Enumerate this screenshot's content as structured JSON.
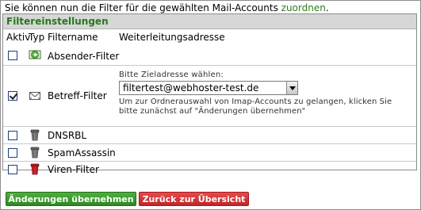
{
  "intro": {
    "text": "Sie können nun die Filter für die gewählten Mail-Accounts ",
    "link": "zuordnen",
    "suffix": "."
  },
  "box": {
    "title": "Filtereinstellungen"
  },
  "columns": {
    "active": "Aktiv",
    "type": "Typ",
    "name": "Filtername",
    "forward": "Weiterleitungsadresse"
  },
  "filters": [
    {
      "name": "Absender-Filter",
      "checked": false,
      "icon": "envelope-arrow-icon"
    },
    {
      "name": "Betreff-Filter",
      "checked": true,
      "icon": "envelope-icon"
    },
    {
      "name": "DNSRBL",
      "checked": false,
      "icon": "trash-can-icon"
    },
    {
      "name": "SpamAssassin",
      "checked": false,
      "icon": "trash-can-icon"
    },
    {
      "name": "Viren-Filter",
      "checked": false,
      "icon": "red-trash-can-icon"
    }
  ],
  "target": {
    "label": "Bitte Zieladresse wählen:",
    "selected": "filtertest@webhoster-test.de",
    "hint": "Um zur Ordnerauswahl von Imap-Accounts zu gelangen, klicken Sie bitte zunächst auf \"Änderungen übernehmen\""
  },
  "buttons": {
    "apply": "Änderungen übernehmen",
    "back": "Zurück zur Übersicht"
  },
  "colors": {
    "accent_green": "#26781a",
    "button_green": "#2c8a1f",
    "button_red": "#c0262a"
  }
}
